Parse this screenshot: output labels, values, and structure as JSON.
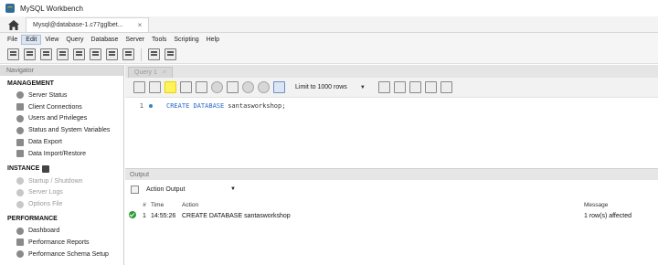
{
  "window": {
    "title": "MySQL Workbench"
  },
  "connection_tab": {
    "label": "Mysql@database-1.c77gglbet...",
    "close": "×"
  },
  "menu": [
    "File",
    "Edit",
    "View",
    "Query",
    "Database",
    "Server",
    "Tools",
    "Scripting",
    "Help"
  ],
  "navigator": {
    "header": "Navigator",
    "management": {
      "title": "MANAGEMENT",
      "items": [
        "Server Status",
        "Client Connections",
        "Users and Privileges",
        "Status and System Variables",
        "Data Export",
        "Data Import/Restore"
      ]
    },
    "instance": {
      "title": "INSTANCE",
      "items": [
        "Startup / Shutdown",
        "Server Logs",
        "Options File"
      ]
    },
    "performance": {
      "title": "PERFORMANCE",
      "items": [
        "Dashboard",
        "Performance Reports",
        "Performance Schema Setup"
      ]
    }
  },
  "editor": {
    "tab_label": "Query 1",
    "tab_close": "×",
    "limit_label": "Limit to 1000 rows",
    "line_number": "1",
    "code_keywords": "CREATE DATABASE",
    "code_identifier": "santasworkshop;"
  },
  "output": {
    "header": "Output",
    "select_label": "Action Output",
    "columns": {
      "num": "#",
      "time": "Time",
      "action": "Action",
      "message": "Message"
    },
    "rows": [
      {
        "num": "1",
        "time": "14:55:26",
        "action": "CREATE DATABASE santasworkshop",
        "message": "1 row(s) affected",
        "status": "success"
      }
    ]
  },
  "colors": {
    "execute_highlight": "#fff35c",
    "success": "#2e9b3a",
    "keyword": "#2a67c9"
  }
}
